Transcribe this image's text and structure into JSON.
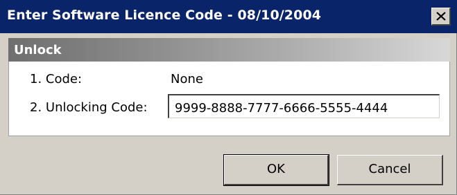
{
  "window": {
    "title": "Enter Software Licence Code - 08/10/2004",
    "close_icon": "close-icon"
  },
  "unlock_section": {
    "header": "Unlock",
    "code_label": "1. Code:",
    "code_value": "None",
    "unlocking_code_label": "2. Unlocking Code:",
    "unlocking_code_value": "9999-8888-7777-6666-5555-4444"
  },
  "buttons": {
    "ok_label": "OK",
    "cancel_label": "Cancel"
  },
  "colors": {
    "titlebar": "#0a246a",
    "dialog_face": "#d4d0c8"
  }
}
